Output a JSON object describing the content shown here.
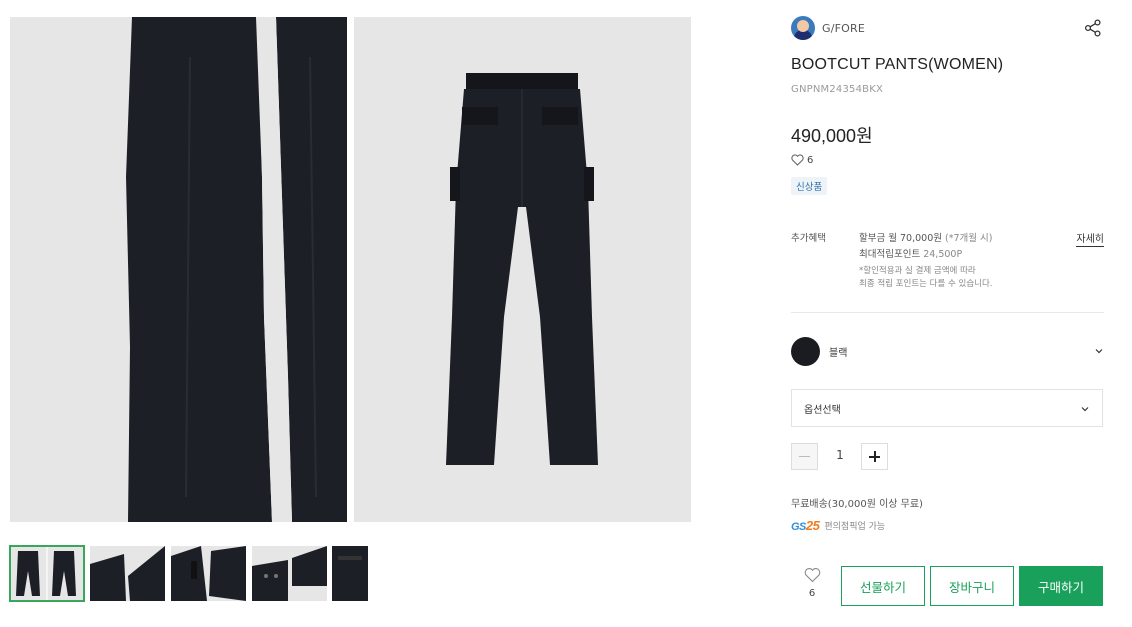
{
  "product": {
    "brand": "G/FORE",
    "title": "BOOTCUT PANTS(WOMEN)",
    "sku": "GNPNM24354BKX",
    "price": "490,000원",
    "likes": "6",
    "badge": "신상품"
  },
  "gallery": {
    "main_images": [
      "pants-front-closeup",
      "pants-back-full"
    ],
    "thumbnails": [
      "pants-front-back",
      "pants-detail-1",
      "pants-detail-2",
      "pants-detail-3",
      "pants-detail-4"
    ],
    "selected_thumbnail": 0
  },
  "benefit": {
    "label": "추가혜택",
    "installment": "할부금 월 70,000원",
    "installment_note": "(*7개월 시)",
    "points_label": "최대적립포인트",
    "points_value": "24,500P",
    "note_line1": "*할인적용과 실 결제 금액에 따라",
    "note_line2": "최종 적립 포인트는 다를 수 있습니다.",
    "more": "자세히"
  },
  "color": {
    "name": "블랙",
    "swatch": "#1b1c22"
  },
  "option": {
    "placeholder": "옵션선택"
  },
  "quantity": {
    "value": "1"
  },
  "shipping": {
    "text": "무료배송(30,000원 이상 무료)",
    "gs_logo_prefix": "GS",
    "gs_logo_num": "25",
    "gs_text": "편의점픽업 가능"
  },
  "actions": {
    "wish_count": "6",
    "gift": "선물하기",
    "cart": "장바구니",
    "buy": "구매하기"
  },
  "colors": {
    "accent": "#19a05a",
    "badge_text": "#2f6fa8",
    "thumb_selected": "#3aa65b"
  }
}
